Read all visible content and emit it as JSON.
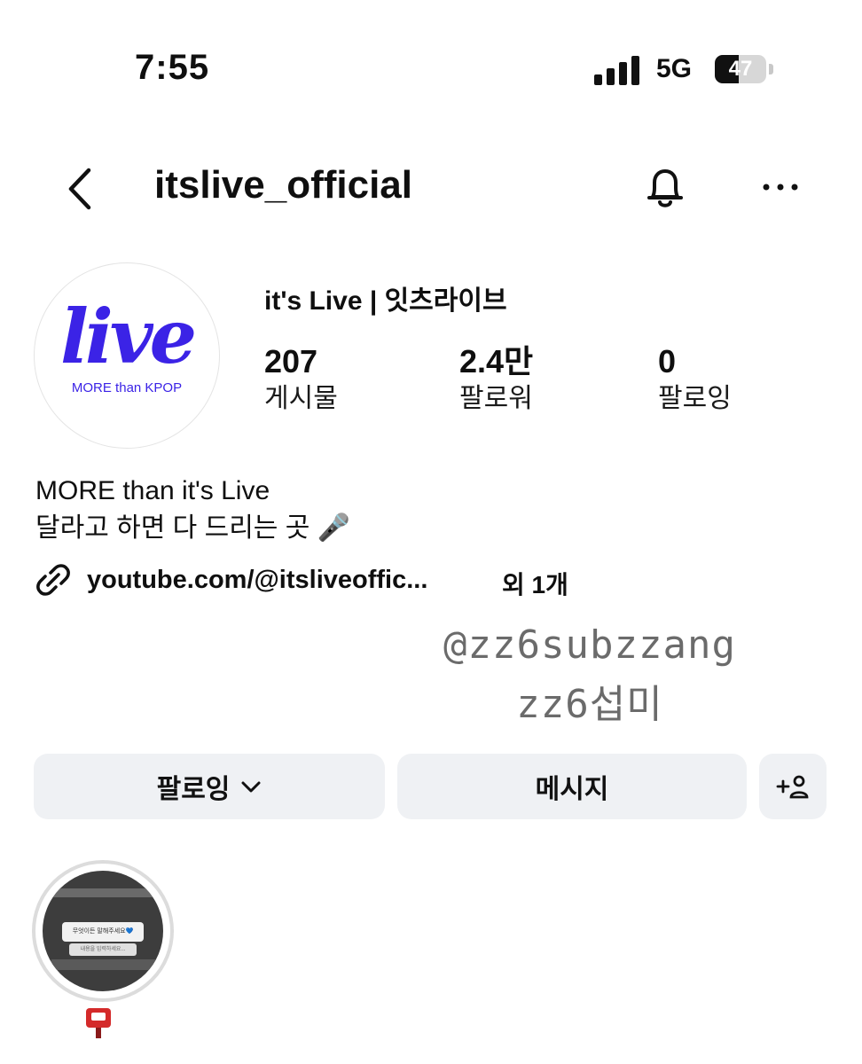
{
  "status_bar": {
    "time": "7:55",
    "network": "5G",
    "battery_level": 47,
    "battery_text": "47"
  },
  "header": {
    "username": "itslive_official",
    "icons": [
      "back-icon",
      "bell-icon",
      "more-icon"
    ]
  },
  "profile": {
    "avatar_logo_text": "live",
    "avatar_tagline": "MORE than KPOP",
    "display_name": "it's Live | 잇츠라이브",
    "stats": [
      {
        "count": "207",
        "label": "게시물"
      },
      {
        "count": "2.4만",
        "label": "팔로워"
      },
      {
        "count": "0",
        "label": "팔로잉"
      }
    ],
    "bio": [
      "MORE than it's Live",
      "달라고 하면 다 드리는 곳 🎤"
    ],
    "link": {
      "text": "youtube.com/@itsliveoffic...",
      "extra": "외 1개"
    }
  },
  "watermark": {
    "line1": "@zz6subzzang",
    "line2": "zz6섭미"
  },
  "actions": {
    "following_label": "팔로잉",
    "message_label": "메시지",
    "add_person_label": "+ዱ"
  },
  "highlight": {
    "card_title": "무엇이든 말해주세요💙",
    "card_input": "내용을 입력하세요..."
  },
  "colors": {
    "brand": "#3b23e6",
    "button_bg": "#eff1f4"
  }
}
